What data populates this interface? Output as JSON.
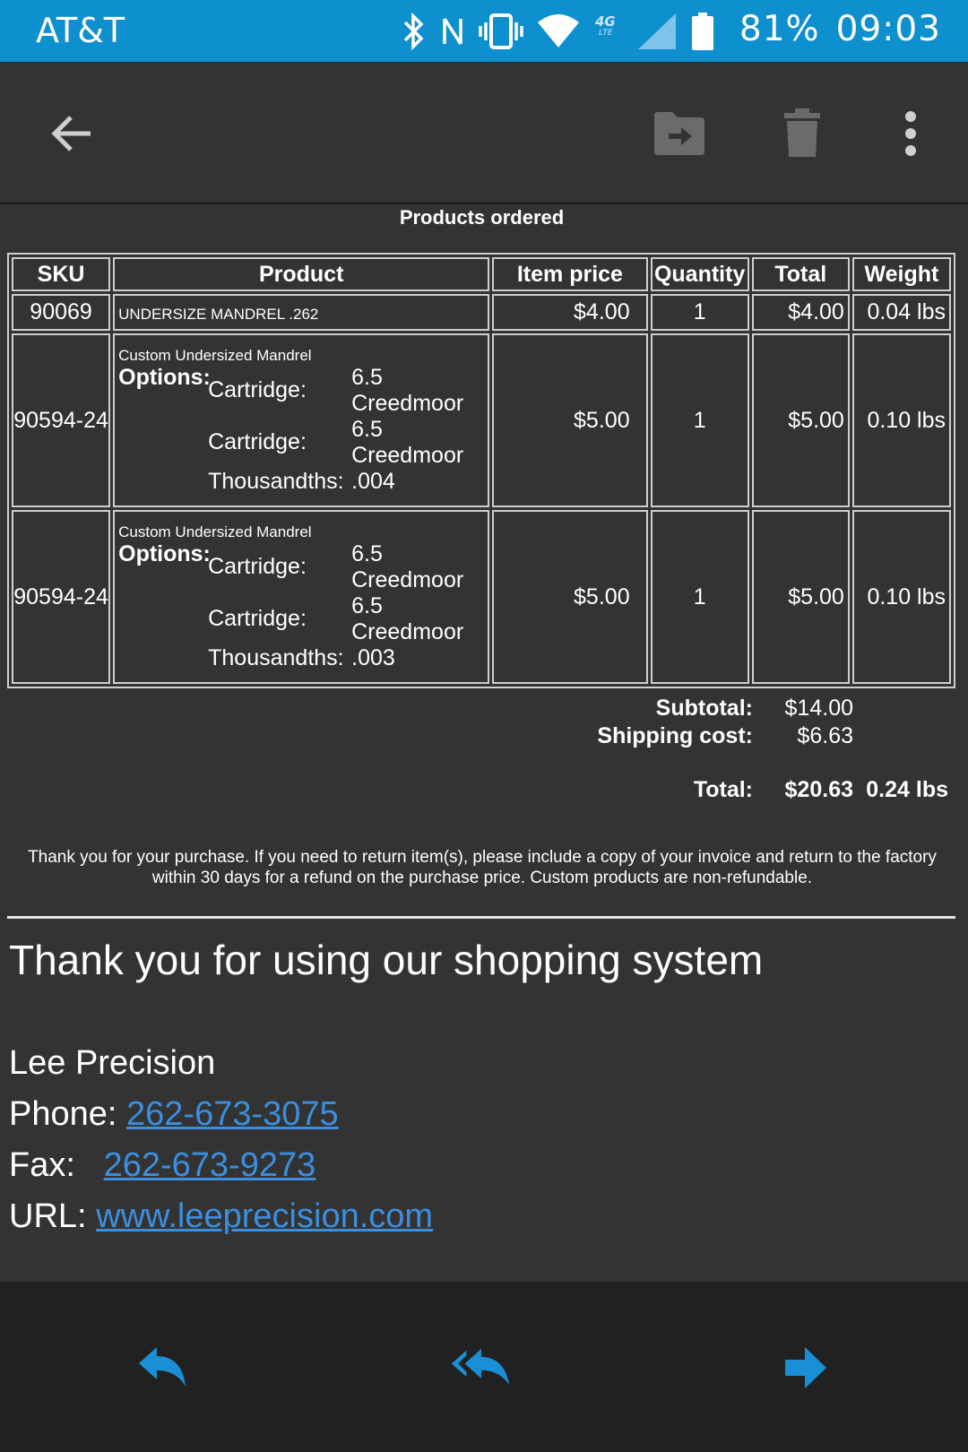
{
  "status_bar": {
    "carrier": "AT&T",
    "battery": "81%",
    "time": "09:03",
    "network_label": "4G LTE",
    "icons": [
      "bluetooth-icon",
      "nfc-icon",
      "vibrate-icon",
      "wifi-icon",
      "lte-icon",
      "signal-icon",
      "battery-icon"
    ]
  },
  "toolbar": {
    "icons": [
      "back-arrow-icon",
      "move-to-folder-icon",
      "trash-icon",
      "more-vert-icon"
    ]
  },
  "order": {
    "section_title": "Products ordered",
    "headers": [
      "SKU",
      "Product",
      "Item price",
      "Quantity",
      "Total",
      "Weight"
    ],
    "rows": [
      {
        "sku": "90069",
        "product": "UNDERSIZE MANDREL .262",
        "price": "$4.00",
        "qty": "1",
        "total": "$4.00",
        "weight": "0.04 lbs"
      },
      {
        "sku": "90594-24",
        "product": "Custom Undersized Mandrel",
        "options_label": "Options:",
        "options": [
          {
            "key": "Cartridge:",
            "value": "6.5 Creedmoor"
          },
          {
            "key": "Cartridge:",
            "value": "6.5 Creedmoor"
          },
          {
            "key": "Thousandths:",
            "value": ".004"
          }
        ],
        "price": "$5.00",
        "qty": "1",
        "total": "$5.00",
        "weight": "0.10 lbs"
      },
      {
        "sku": "90594-24",
        "product": "Custom Undersized Mandrel",
        "options_label": "Options:",
        "options": [
          {
            "key": "Cartridge:",
            "value": "6.5 Creedmoor"
          },
          {
            "key": "Cartridge:",
            "value": "6.5 Creedmoor"
          },
          {
            "key": "Thousandths:",
            "value": ".003"
          }
        ],
        "price": "$5.00",
        "qty": "1",
        "total": "$5.00",
        "weight": "0.10 lbs"
      }
    ],
    "subtotal_label": "Subtotal:",
    "subtotal": "$14.00",
    "shipping_label": "Shipping cost:",
    "shipping": "$6.63",
    "total_label": "Total:",
    "total": "$20.63",
    "total_weight": "0.24 lbs"
  },
  "note": "Thank you for your purchase. If you need to return item(s), please include a copy of your invoice and return to the factory within 30 days for a refund on the purchase price. Custom products are non-refundable.",
  "thanks": "Thank you for using our shopping system",
  "contact": {
    "company": "Lee Precision",
    "phone_label": "Phone:",
    "phone": "262-673-3075",
    "fax_label": "Fax:",
    "fax": "262-673-9273",
    "url_label": "URL:",
    "url": "www.leeprecision.com"
  },
  "bottom_bar": {
    "icons": [
      "reply-icon",
      "reply-all-icon",
      "forward-icon"
    ],
    "accent": "#1a8fd6"
  },
  "colors": {
    "status_bar": "#0e8fce",
    "background": "#333333",
    "link": "#3b8fe0",
    "bottom_bar": "#212121"
  }
}
